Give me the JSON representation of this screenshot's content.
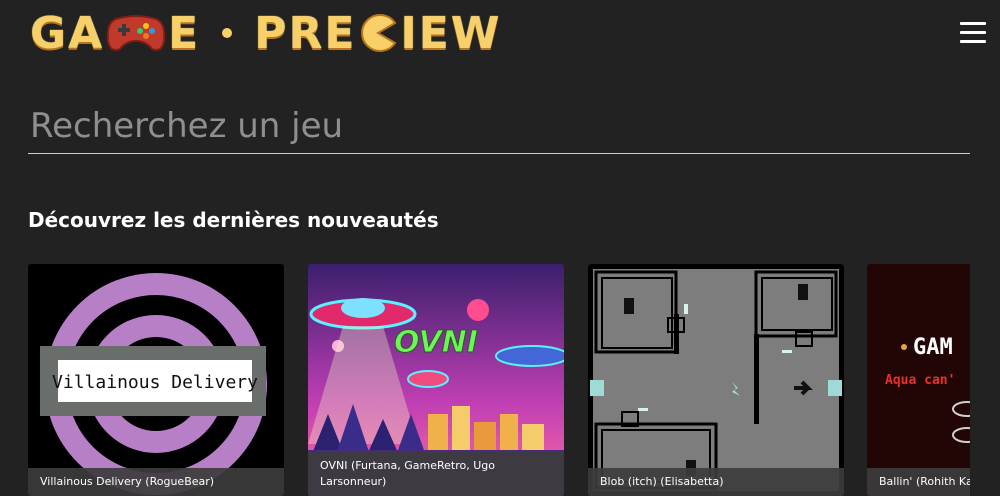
{
  "header": {
    "logo_left": "GA",
    "logo_mid": "E",
    "logo_right_a": "PRE",
    "logo_right_b": "IEW",
    "menu_icon": "hamburger-icon"
  },
  "search": {
    "placeholder": "Recherchez un jeu",
    "value": ""
  },
  "section": {
    "title": "Découvrez les dernières nouveautés"
  },
  "games": [
    {
      "caption": "Villainous Delivery (RogueBear)",
      "thumb_text": "Villainous Delivery"
    },
    {
      "caption": "OVNI (Furtana, GameRetro, Ugo Larsonneur)",
      "thumb_text": "OVNI"
    },
    {
      "caption": "Blob (itch) (Elisabetta)"
    },
    {
      "caption": "Ballin' (Rohith Ka",
      "thumb_text_a": "GAM",
      "thumb_text_b": "Aqua can'"
    }
  ],
  "colors": {
    "background": "#222222",
    "logo": "#f7d06a",
    "accent_purple": "#b77fc6"
  }
}
